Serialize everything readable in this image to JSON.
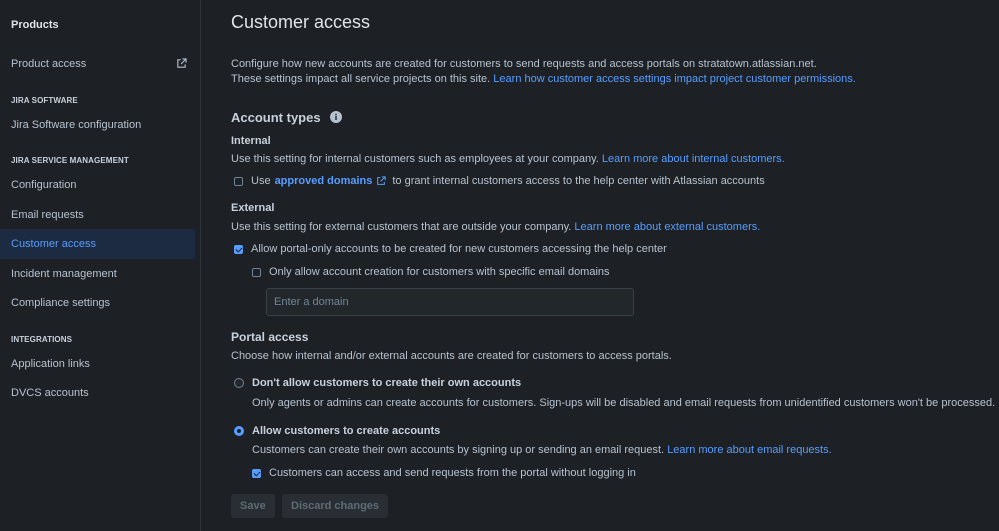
{
  "sidebar": {
    "products_heading": "Products",
    "product_access": "Product access",
    "sections": {
      "jira_software": "JIRA SOFTWARE",
      "jira_service_management": "JIRA SERVICE MANAGEMENT",
      "integrations": "INTEGRATIONS"
    },
    "items": {
      "jira_software_configuration": "Jira Software configuration",
      "configuration": "Configuration",
      "email_requests": "Email requests",
      "customer_access": "Customer access",
      "incident_management": "Incident management",
      "compliance_settings": "Compliance settings",
      "application_links": "Application links",
      "dvcs_accounts": "DVCS accounts"
    }
  },
  "page": {
    "title": "Customer access",
    "description_line1": "Configure how new accounts are created for customers to send requests and access portals on stratatown.atlassian.net.",
    "description_line2": "These settings impact all service projects on this site.",
    "description_link": "Learn how customer access settings impact project customer permissions."
  },
  "account_types": {
    "heading": "Account types",
    "internal": {
      "heading": "Internal",
      "text": "Use this setting for internal customers such as employees at your company.",
      "link": "Learn more about internal customers.",
      "checkbox_prefix": "Use",
      "checkbox_link": "approved domains",
      "checkbox_suffix": "to grant internal customers access to the help center with Atlassian accounts",
      "checked": false
    },
    "external": {
      "heading": "External",
      "text": "Use this setting for external customers that are outside your company.",
      "link": "Learn more about external customers.",
      "portal_only_label": "Allow portal-only accounts to be created for new customers accessing the help center",
      "portal_only_checked": true,
      "domains_only_label": "Only allow account creation for customers with specific email domains",
      "domains_only_checked": false,
      "domain_placeholder": "Enter a domain"
    }
  },
  "portal_access": {
    "heading": "Portal access",
    "text": "Choose how internal and/or external accounts are created for customers to access portals.",
    "options": {
      "disallow": {
        "label": "Don't allow customers to create their own accounts",
        "description": "Only agents or admins can create accounts for customers. Sign-ups will be disabled and email requests from unidentified customers won't be processed.",
        "selected": false
      },
      "allow": {
        "label": "Allow customers to create accounts",
        "description": "Customers can create their own accounts by signing up or sending an email request.",
        "link": "Learn more about email requests.",
        "selected": true
      }
    },
    "no_login_label": "Customers can access and send requests from the portal without logging in",
    "no_login_checked": true
  },
  "buttons": {
    "save": "Save",
    "discard": "Discard changes"
  },
  "colors": {
    "background": "#1d2125",
    "accent": "#579dff",
    "active_item_bg": "#1c2b41"
  },
  "icons": {
    "external_link": "external-link-icon",
    "info": "info-icon"
  }
}
